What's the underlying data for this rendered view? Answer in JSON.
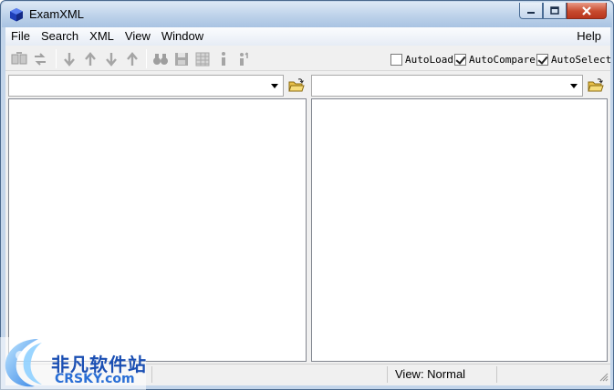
{
  "window": {
    "title": "ExamXML"
  },
  "menu": {
    "file": "File",
    "search": "Search",
    "xml": "XML",
    "view": "View",
    "window": "Window",
    "help": "Help"
  },
  "toolbar": {
    "icons": [
      "compare-icon",
      "swap-icon",
      "next-diff-icon",
      "prev-diff-icon",
      "next-icon",
      "prev-icon",
      "find-icon",
      "save-icon",
      "grid-icon",
      "info-icon",
      "sort-icon"
    ],
    "autoload": {
      "label": "AutoLoad",
      "checked": false
    },
    "autocompare": {
      "label": "AutoCompare",
      "checked": true
    },
    "autoselect": {
      "label": "AutoSelect",
      "checked": true
    }
  },
  "left_pane": {
    "file_value": ""
  },
  "right_pane": {
    "file_value": ""
  },
  "statusbar": {
    "view_mode": "View: Normal"
  },
  "watermark": {
    "cn_text": "非凡软件站",
    "en_text": "CRSKY.com"
  },
  "colors": {
    "titlebar": "#bdd2ea",
    "close_button": "#c74a2e",
    "watermark_blue": "#1b4fb3"
  }
}
